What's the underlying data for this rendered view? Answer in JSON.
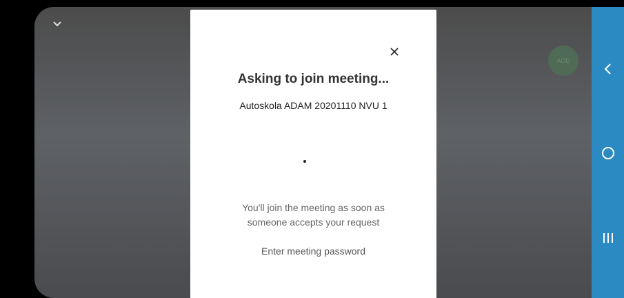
{
  "dialog": {
    "title": "Asking to join meeting...",
    "meeting_name": "Autoskola ADAM 20201110 NVU 1",
    "info_line1": "You'll join the meeting as soon as",
    "info_line2": "someone accepts your request",
    "password_link": "Enter meeting password"
  },
  "participant": {
    "initials": "AOD"
  },
  "colors": {
    "nav_bar": "#2b8ac2",
    "dialog_bg": "#ffffff",
    "avatar": "#4f6b55"
  },
  "icons": {
    "collapse": "chevron-down-icon",
    "close": "close-icon",
    "nav_back": "chevron-left-icon",
    "nav_home": "home-circle-icon",
    "nav_recents": "recents-icon"
  }
}
